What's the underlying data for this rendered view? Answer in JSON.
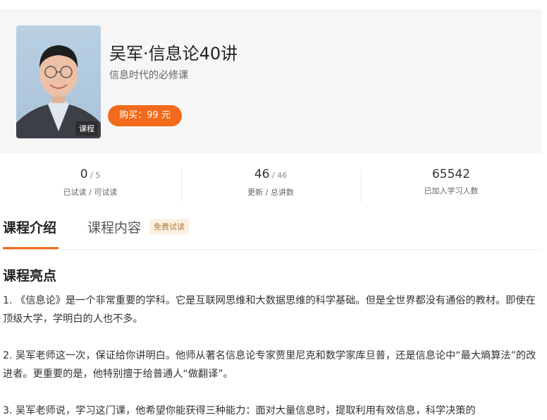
{
  "course": {
    "title": "吴军·信息论40讲",
    "subtitle": "信息时代的必修课",
    "cover_tag": "课程",
    "buy_button": "购买：99 元"
  },
  "stats": [
    {
      "value": "0",
      "total": " / 5",
      "label": "已试读 / 可试读"
    },
    {
      "value": "46",
      "total": " / 46",
      "label": "更新 / 总讲数"
    },
    {
      "value": "65542",
      "total": "",
      "label": "已加入学习人数"
    }
  ],
  "tabs": {
    "intro": "课程介绍",
    "content": "课程内容",
    "free_badge": "免费试读"
  },
  "section": {
    "title": "课程亮点",
    "paragraphs": [
      "1. 《信息论》是一个非常重要的学科。它是互联网思维和大数据思维的科学基础。但是全世界都没有通俗的教材。即使在顶级大学，学明白的人也不多。",
      "2. 吴军老师这一次，保证给你讲明白。他师从著名信息论专家贾里尼克和数学家库旦普，还是信息论中“最大熵算法”的改进者。更重要的是，他特别擅于给普通人“做翻译”。",
      "3. 吴军老师说，学习这门课，他希望你能获得三种能力：面对大量信息时，提取利用有效信息，科学决策的"
    ]
  },
  "colors": {
    "accent": "#f26a1b",
    "header_bg": "#f6f6f7",
    "badge_bg": "#fbf1e2"
  }
}
